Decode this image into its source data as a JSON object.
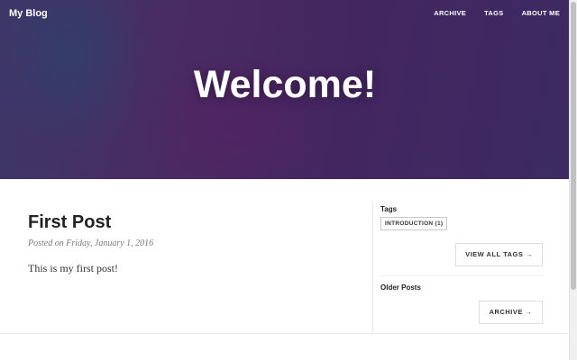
{
  "header": {
    "brand": "My Blog",
    "nav": [
      {
        "label": "ARCHIVE"
      },
      {
        "label": "TAGS"
      },
      {
        "label": "ABOUT ME"
      }
    ],
    "hero_title": "Welcome!"
  },
  "post": {
    "title": "First Post",
    "meta": "Posted on Friday, January 1, 2016",
    "excerpt": "This is my first post!"
  },
  "sidebar": {
    "tags_heading": "Tags",
    "tags": [
      {
        "label": "INTRODUCTION (1)"
      }
    ],
    "view_all_tags_label": "VIEW ALL TAGS →",
    "older_posts_heading": "Older Posts",
    "archive_label": "ARCHIVE →"
  },
  "colors": {
    "hero_purple": "#432660",
    "hero_blue": "#3d3768",
    "text": "#222222",
    "muted": "#7a7a7a"
  }
}
